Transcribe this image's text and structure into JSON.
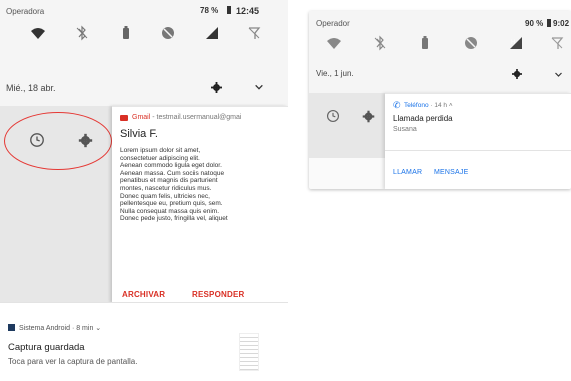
{
  "left_screen": {
    "status_bar": {
      "carrier": "Operadora",
      "battery": "78 %",
      "time": "12:45"
    },
    "date": "Mié., 18 abr.",
    "email_notification": {
      "app": "Gmail",
      "account": "testmail.usermanual@gmai",
      "sender": "Silvia F.",
      "body": "Lorem ipsum dolor sit amet,\nconsectetuer adipiscing elit.\nAenean commodo ligula eget dolor.\nAenean massa. Cum sociis natoque\npenatibus et magnis dis parturient\nmontes, nascetur ridiculus mus.\nDonec quam felis, ultricies nec,\npellentesque eu, pretium quis, sem.\nNulla consequat massa quis enim.\nDonec pede justo, fringilla vel, aliquet",
      "actions": {
        "archive": "ARCHIVAR",
        "reply": "RESPONDER"
      }
    },
    "system_notification": {
      "app": "Sistema Android",
      "meta": "8 min",
      "title": "Captura guardada",
      "text": "Toca para ver la captura de pantalla."
    },
    "colors": {
      "accent_red": "#d93025",
      "highlight_ring": "#e53935"
    }
  },
  "right_screen": {
    "status_bar": {
      "carrier": "Operador",
      "battery": "90 %",
      "time": "9:02"
    },
    "date": "Vie., 1 jun.",
    "call_notification": {
      "app": "Teléfono",
      "meta": "14 h",
      "title": "Llamada perdida",
      "caller": "Susana",
      "actions": {
        "call": "LLAMAR",
        "message": "MENSAJE"
      }
    },
    "colors": {
      "accent_blue": "#1a73e8"
    }
  }
}
